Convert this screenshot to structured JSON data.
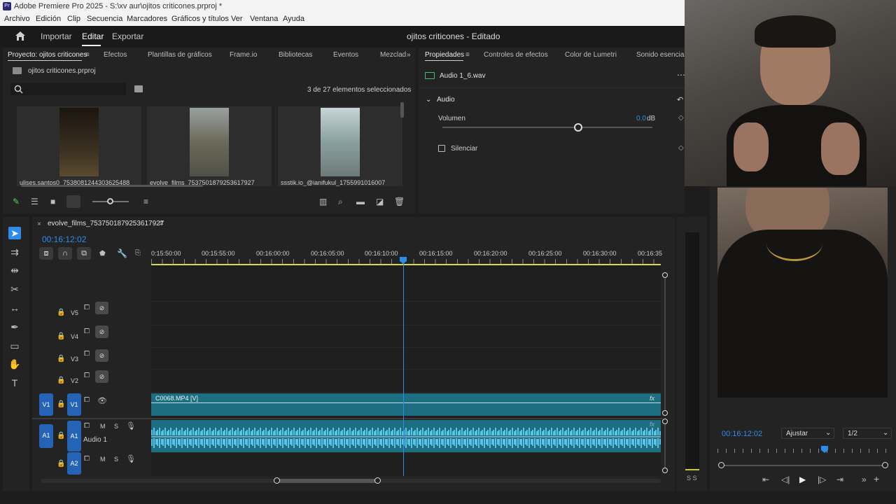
{
  "window": {
    "title": "Adobe Premiere Pro 2025 - S:\\xv aur\\ojitos criticones.prproj *",
    "app_badge": "Pr"
  },
  "menu": [
    "Archivo",
    "Edición",
    "Clip",
    "Secuencia",
    "Marcadores",
    "Gráficos y títulos",
    "Ver",
    "Ventana",
    "Ayuda"
  ],
  "header": {
    "import": "Importar",
    "edit": "Editar",
    "export": "Exportar",
    "project_title": "ojitos criticones - Editado"
  },
  "project_panel": {
    "tabs": [
      "Proyecto: ojitos criticones",
      "Efectos",
      "Plantillas de gráficos",
      "Frame.io",
      "Bibliotecas",
      "Eventos",
      "Mezclad"
    ],
    "file": "ojitos criticones.prproj",
    "selection": "3 de 27 elementos seleccionados",
    "clips": [
      {
        "name": "ulises.santos0_7538081244303625488",
        "color": "#3a3020"
      },
      {
        "name": "evolve_films_7537501879253617927",
        "color": "#6a6a58"
      },
      {
        "name": "ssstik.io_@ianifukul_1755991016007",
        "color": "#8aa0a0"
      }
    ]
  },
  "properties_panel": {
    "tabs": [
      "Propiedades",
      "Controles de efectos",
      "Color de Lumetri",
      "Sonido esencial"
    ],
    "clip": "Audio 1_6.wav",
    "section": "Audio",
    "volume_label": "Volumen",
    "volume_value": "0.0",
    "volume_unit": "dB",
    "mute_label": "Silenciar"
  },
  "timeline": {
    "sequence": "evolve_films_7537501879253617927",
    "timecode": "00:16:12:02",
    "ruler": [
      "0:15:50:00",
      "00:15:55:00",
      "00:16:00:00",
      "00:16:05:00",
      "00:16:10:00",
      "00:16:15:00",
      "00:16:20:00",
      "00:16:25:00",
      "00:16:30:00",
      "00:16:35"
    ],
    "video_tracks": [
      "V5",
      "V4",
      "V3",
      "V2",
      "V1"
    ],
    "audio_tracks": [
      "A1",
      "A2"
    ],
    "audio_track_name": "Audio 1",
    "video_clip": "C0068.MP4 [V]",
    "m": "M",
    "s": "S",
    "fx": "fx",
    "meter_s": "S S"
  },
  "program": {
    "timecode": "00:16:12:02",
    "fit": "Ajustar",
    "resolution": "1/2"
  },
  "colors": {
    "accent": "#2d8ceb",
    "clip_teal": "#1e6e82",
    "audio_wave": "#5cc3e8"
  }
}
